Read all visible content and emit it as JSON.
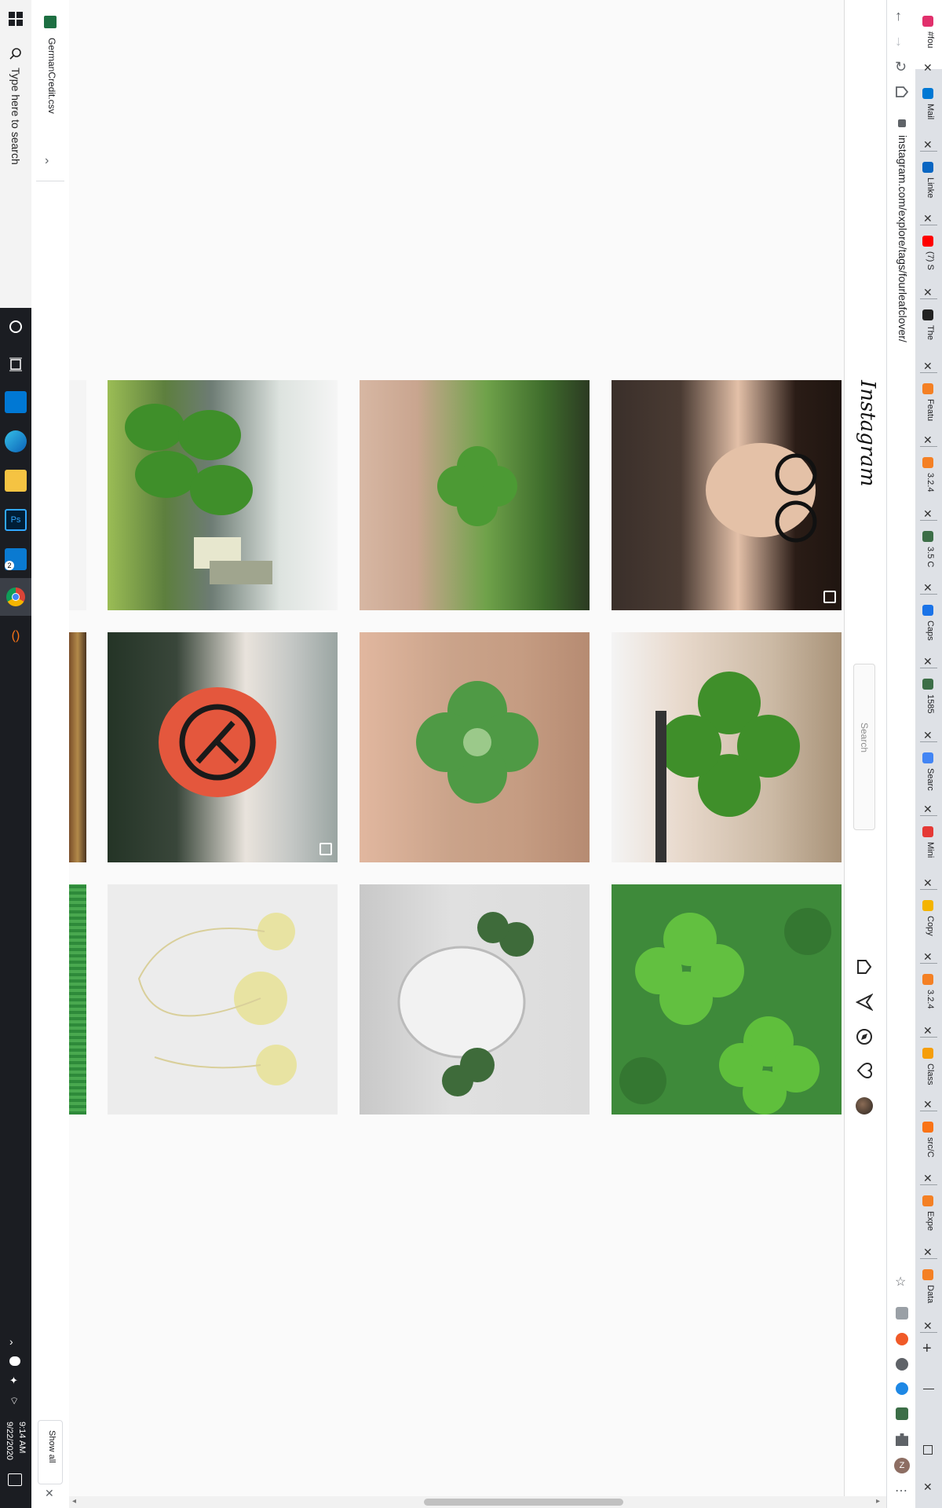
{
  "taskbar": {
    "search_placeholder": "Type here to search",
    "time": "9:14 AM",
    "date": "9/22/2020",
    "vscode_badge": "2"
  },
  "downloads": {
    "file_name": "GermanCredit.csv",
    "show_all": "Show all"
  },
  "browser": {
    "url": "instagram.com/explore/tags/fourleafclover/",
    "tabs": [
      {
        "title": "#fou",
        "color": "#e1306c"
      },
      {
        "title": "Mail",
        "color": "#0078d4"
      },
      {
        "title": "Linke",
        "color": "#0a66c2"
      },
      {
        "title": "(7) S",
        "color": "#ff0000"
      },
      {
        "title": "The",
        "color": "#222222"
      },
      {
        "title": "Featu",
        "color": "#f48024"
      },
      {
        "title": "3.2.4",
        "color": "#f48024"
      },
      {
        "title": "3.5 C",
        "color": "#3c6e47"
      },
      {
        "title": "Caps",
        "color": "#1a73e8"
      },
      {
        "title": "1585",
        "color": "#3c6e47"
      },
      {
        "title": "Searc",
        "color": "#4285f4"
      },
      {
        "title": "Mini",
        "color": "#e53935"
      },
      {
        "title": "Copy",
        "color": "#f4b400"
      },
      {
        "title": "3.2.4",
        "color": "#f48024"
      },
      {
        "title": "Class",
        "color": "#f59e0b"
      },
      {
        "title": "src/C",
        "color": "#f97316"
      },
      {
        "title": "Expe",
        "color": "#f48024"
      },
      {
        "title": "Data",
        "color": "#f48024"
      }
    ]
  },
  "instagram": {
    "logo": "Instagram",
    "search_placeholder": "Search",
    "nav_icons": [
      "home-icon",
      "direct-icon",
      "explore-icon",
      "activity-icon",
      "profile-avatar"
    ]
  },
  "grid": {
    "posts": [
      {
        "subject": "clover against sky and house",
        "multi": false
      },
      {
        "subject": "hand holding four-leaf clover",
        "multi": false
      },
      {
        "subject": "person with curly hair and glasses",
        "multi": true
      },
      {
        "subject": "forearm with red tattoo",
        "multi": true
      },
      {
        "subject": "four-leaf clover held over brick",
        "multi": false
      },
      {
        "subject": "four-leaf clover near wooden railing",
        "multi": false
      },
      {
        "subject": "pressed yellow clovers",
        "multi": false
      },
      {
        "subject": "clovers in glass vase",
        "multi": false
      },
      {
        "subject": "field of bright green clovers",
        "multi": false
      }
    ]
  }
}
